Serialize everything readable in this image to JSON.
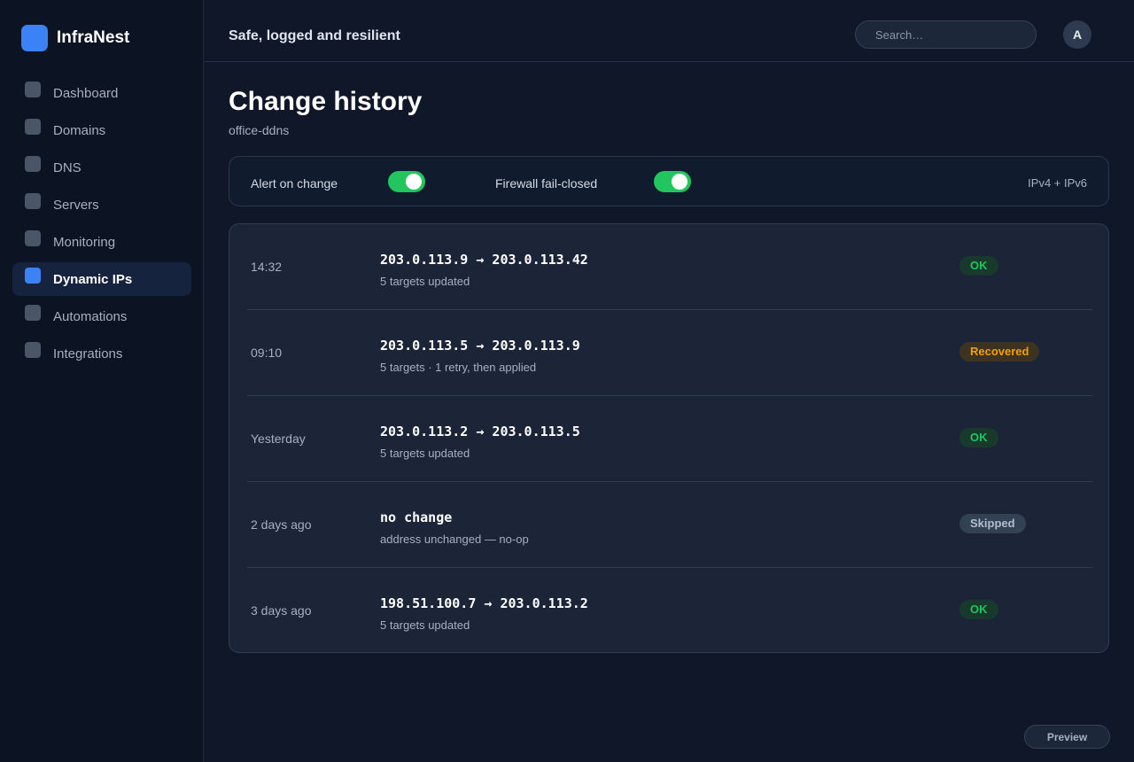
{
  "brand": {
    "name": "InfraNest",
    "accent": "#3b82f6"
  },
  "sidebar": {
    "items": [
      {
        "label": "Dashboard",
        "icon": "dashboard-icon",
        "active": false
      },
      {
        "label": "Domains",
        "icon": "domains-icon",
        "active": false
      },
      {
        "label": "DNS",
        "icon": "dns-icon",
        "active": false
      },
      {
        "label": "Servers",
        "icon": "servers-icon",
        "active": false
      },
      {
        "label": "Monitoring",
        "icon": "monitoring-icon",
        "active": false
      },
      {
        "label": "Dynamic IPs",
        "icon": "dynamic-ips-icon",
        "active": true
      },
      {
        "label": "Automations",
        "icon": "automations-icon",
        "active": false
      },
      {
        "label": "Integrations",
        "icon": "integrations-icon",
        "active": false
      }
    ]
  },
  "header": {
    "tagline": "Safe, logged and resilient",
    "search_placeholder": "Search…",
    "avatar_initial": "A"
  },
  "page": {
    "title": "Change history",
    "subtitle": "office-ddns"
  },
  "settings": {
    "alert_label": "Alert on change",
    "alert_enabled": true,
    "firewall_label": "Firewall fail-closed",
    "firewall_enabled": true,
    "ip_mode": "IPv4 + IPv6",
    "toggle_color": "#22c55e"
  },
  "history": [
    {
      "when": "14:32",
      "change": "203.0.113.9 → 203.0.113.42",
      "detail": "5 targets updated",
      "status": "OK",
      "status_type": "ok"
    },
    {
      "when": "09:10",
      "change": "203.0.113.5 → 203.0.113.9",
      "detail": "5 targets · 1 retry, then applied",
      "status": "Recovered",
      "status_type": "warn"
    },
    {
      "when": "Yesterday",
      "change": "203.0.113.2 → 203.0.113.5",
      "detail": "5 targets updated",
      "status": "OK",
      "status_type": "ok"
    },
    {
      "when": "2 days ago",
      "change": "no change",
      "detail": "address unchanged — no-op",
      "status": "Skipped",
      "status_type": "skip"
    },
    {
      "when": "3 days ago",
      "change": "198.51.100.7 → 203.0.113.2",
      "detail": "5 targets updated",
      "status": "OK",
      "status_type": "ok"
    }
  ],
  "footer": {
    "preview_label": "Preview"
  }
}
